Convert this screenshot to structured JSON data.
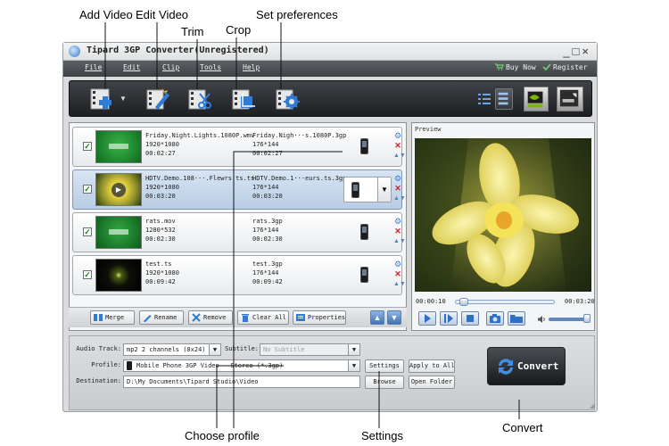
{
  "callouts": {
    "add_video": "Add Video",
    "edit_video": "Edit Video",
    "trim": "Trim",
    "crop": "Crop",
    "set_preferences": "Set preferences",
    "choose_profile": "Choose profile",
    "settings": "Settings",
    "convert": "Convert"
  },
  "window": {
    "title": "Tipard 3GP Converter(Unregistered)",
    "controls": "_□×"
  },
  "menu": {
    "file": "File",
    "edit": "Edit",
    "clip": "Clip",
    "tools": "Tools",
    "help": "Help",
    "buy_now": "Buy Now",
    "register": "Register"
  },
  "toolbar": {
    "icons": [
      "add-video-icon",
      "edit-video-icon",
      "trim-icon",
      "crop-icon",
      "preferences-icon"
    ],
    "view_icons": [
      "list-view-icon",
      "detail-view-icon",
      "nvidia-icon",
      "amd-icon"
    ]
  },
  "files": [
    {
      "checked": true,
      "selected": false,
      "thumb": "green-logo",
      "src_name": "Friday.Night.Lights.1080P.wmv",
      "src_res": "1920*1080",
      "src_dur": "00:02:27",
      "out_name": "Friday.Nigh···s.1080P.3gp",
      "out_res": "176*144",
      "out_dur": "00:02:27"
    },
    {
      "checked": true,
      "selected": true,
      "thumb": "flower",
      "src_name": "HDTV.Demo.108···.Flewrs.ts.ts",
      "src_res": "1920*1080",
      "src_dur": "00:03:20",
      "out_name": "HDTV.Demo.1···eurs.ts.3gp",
      "out_res": "176*144",
      "out_dur": "00:03:20"
    },
    {
      "checked": true,
      "selected": false,
      "thumb": "green-logo",
      "src_name": "rats.mov",
      "src_res": "1280*532",
      "src_dur": "00:02:30",
      "out_name": "rats.3gp",
      "out_res": "176*144",
      "out_dur": "00:02:30"
    },
    {
      "checked": true,
      "selected": false,
      "thumb": "dark-flare",
      "src_name": "test.ts",
      "src_res": "1920*1080",
      "src_dur": "00:09:42",
      "out_name": "test.3gp",
      "out_res": "176*144",
      "out_dur": "00:09:42"
    }
  ],
  "actions": {
    "merge": "Merge",
    "rename": "Rename",
    "remove": "Remove",
    "clear_all": "Clear All",
    "properties": "Properties"
  },
  "preview": {
    "label": "Preview",
    "time_current": "00:00:10",
    "time_total": "00:03:20",
    "progress": 0.05,
    "volume": 0.85
  },
  "settings": {
    "audio_track_label": "Audio Track:",
    "audio_track_value": "mp2 2 channels (0x24)",
    "subtitle_label": "Subtitle:",
    "subtitle_value": "No Subtitle",
    "profile_label": "Profile:",
    "profile_value": "Mobile Phone 3GP Video - Stereo (*.3gp)",
    "destination_label": "Destination:",
    "destination_value": "D:\\My Documents\\Tipard Studio\\Video",
    "settings_button": "Settings",
    "apply_to_all_button": "Apply to All",
    "browse_button": "Browse",
    "open_folder_button": "Open Folder",
    "convert_button": "Convert"
  },
  "colors": {
    "toolbar_bg": "#2a2c30",
    "accent_blue": "#2f7bd6",
    "selected_row": "#c4d6ea",
    "remove_red": "#d0211f"
  }
}
